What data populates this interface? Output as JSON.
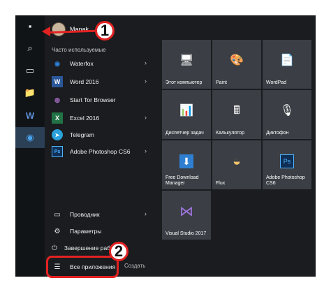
{
  "rail": {
    "items": [
      {
        "name": "windows-logo-icon",
        "glyph": "▪"
      },
      {
        "name": "search-icon",
        "glyph": "⌕"
      },
      {
        "name": "task-view-icon",
        "glyph": "▭"
      },
      {
        "name": "file-explorer-icon",
        "glyph": "📁"
      },
      {
        "name": "word-icon",
        "glyph": "W"
      },
      {
        "name": "waterfox-icon",
        "glyph": "◉"
      }
    ]
  },
  "user": {
    "name": "Manak"
  },
  "section_label": "Часто используемые",
  "apps": [
    {
      "label": "Waterfox",
      "icon": "waterfox-icon",
      "glyph": "◉",
      "color": "#2f7fd8",
      "chevron": true
    },
    {
      "label": "Word 2016",
      "icon": "word-icon",
      "glyph": "W",
      "color": "#2b579a",
      "chevron": true
    },
    {
      "label": "Start Tor Browser",
      "icon": "tor-icon",
      "glyph": "◍",
      "color": "#7e4798",
      "chevron": false
    },
    {
      "label": "Excel 2016",
      "icon": "excel-icon",
      "glyph": "X",
      "color": "#217346",
      "chevron": true
    },
    {
      "label": "Telegram",
      "icon": "telegram-icon",
      "glyph": "➤",
      "color": "#2aa1da",
      "chevron": false
    },
    {
      "label": "Adobe Photoshop CS6",
      "icon": "photoshop-icon",
      "glyph": "Ps",
      "color": "#0f2f55",
      "chevron": true
    }
  ],
  "bottom": [
    {
      "label": "Проводник",
      "icon": "folder-icon",
      "glyph": "▭",
      "chevron": true
    },
    {
      "label": "Параметры",
      "icon": "gear-icon",
      "glyph": "⚙",
      "chevron": false
    },
    {
      "label": "Завершение работы",
      "icon": "power-icon",
      "glyph": "⏻",
      "chevron": false
    },
    {
      "label": "Все приложения",
      "icon": "all-apps-icon",
      "glyph": "☰",
      "chevron": false
    }
  ],
  "create_label": "Создать",
  "tiles": [
    {
      "label": "Этот компьютер",
      "icon": "computer-icon",
      "glyph": "🖥"
    },
    {
      "label": "Paint",
      "icon": "paint-icon",
      "glyph": "🎨"
    },
    {
      "label": "WordPad",
      "icon": "wordpad-icon",
      "glyph": "📄"
    },
    {
      "label": "Диспетчер задач",
      "icon": "task-manager-icon",
      "glyph": "📊"
    },
    {
      "label": "Калькулятор",
      "icon": "calculator-icon",
      "glyph": "🖩"
    },
    {
      "label": "Диктофон",
      "icon": "microphone-icon",
      "glyph": "🎙"
    },
    {
      "label": "Free Download Manager",
      "icon": "download-icon",
      "glyph": "⬇"
    },
    {
      "label": "Flux",
      "icon": "flux-icon",
      "glyph": "◒"
    },
    {
      "label": "Adobe Photoshop CS6",
      "icon": "photoshop-icon",
      "glyph": "Ps"
    },
    {
      "label": "Visual Studio 2017",
      "icon": "visual-studio-icon",
      "glyph": "⋈"
    }
  ],
  "callouts": [
    "1",
    "2"
  ],
  "colors": {
    "accent": "#e32222",
    "tile_bg": "#3b3f45",
    "menu_bg": "#1a1c1f"
  }
}
